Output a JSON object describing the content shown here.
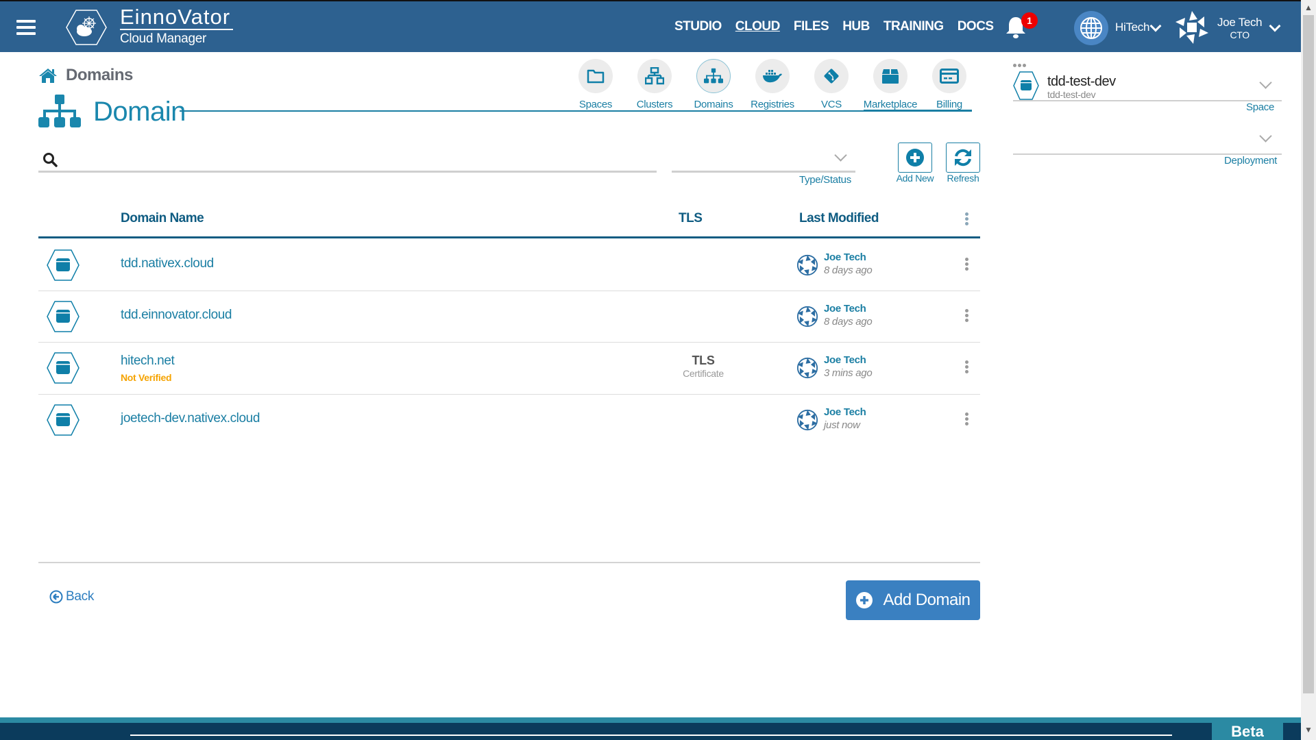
{
  "app": {
    "brand_name": "EinnoVator",
    "brand_sub": "Cloud Manager"
  },
  "topnav": [
    {
      "label": "STUDIO",
      "active": false
    },
    {
      "label": "CLOUD",
      "active": true
    },
    {
      "label": "FILES",
      "active": false
    },
    {
      "label": "HUB",
      "active": false
    },
    {
      "label": "TRAINING",
      "active": false
    },
    {
      "label": "DOCS",
      "active": false
    }
  ],
  "notifications": {
    "count": "1",
    "icon": "bell-icon"
  },
  "org": {
    "name": "HiTech",
    "icon": "globe-icon"
  },
  "user": {
    "name": "Joe Tech",
    "role": "CTO"
  },
  "breadcrumb": {
    "label": "Domains",
    "icon": "home-icon"
  },
  "page": {
    "title": "Domain",
    "icon": "sitemap-icon"
  },
  "quicknav": [
    {
      "label": "Spaces",
      "icon": "folder-icon"
    },
    {
      "label": "Clusters",
      "icon": "network-icon"
    },
    {
      "label": "Domains",
      "icon": "sitemap-icon",
      "active": true
    },
    {
      "label": "Registries",
      "icon": "docker-icon"
    },
    {
      "label": "VCS",
      "icon": "git-icon"
    },
    {
      "label": "Marketplace",
      "icon": "box-icon"
    },
    {
      "label": "Billing",
      "icon": "credit-card-icon"
    }
  ],
  "search": {
    "value": "",
    "placeholder": ""
  },
  "filter": {
    "label": "Type/Status",
    "value": ""
  },
  "toolbar": {
    "add_new": "Add New",
    "refresh": "Refresh"
  },
  "table": {
    "columns": [
      "Domain Name",
      "TLS",
      "Last Modified"
    ],
    "rows": [
      {
        "name": "tdd.nativex.cloud",
        "status": "",
        "tls": "",
        "tls_sub": "",
        "user": "Joe Tech",
        "time": "8 days ago"
      },
      {
        "name": "tdd.einnovator.cloud",
        "status": "",
        "tls": "",
        "tls_sub": "",
        "user": "Joe Tech",
        "time": "8 days ago"
      },
      {
        "name": "hitech.net",
        "status": "Not Verified",
        "tls": "TLS",
        "tls_sub": "Certificate",
        "user": "Joe Tech",
        "time": "3 mins ago"
      },
      {
        "name": "joetech-dev.nativex.cloud",
        "status": "",
        "tls": "",
        "tls_sub": "",
        "user": "Joe Tech",
        "time": "just now"
      }
    ]
  },
  "actions": {
    "back": "Back",
    "add_domain": "Add Domain"
  },
  "right_panel": {
    "space_name": "tdd-test-dev",
    "space_sub": "tdd-test-dev",
    "space_label": "Space",
    "deployment_value": "",
    "deployment_label": "Deployment"
  },
  "footer": {
    "beta": "Beta"
  },
  "colors": {
    "header": "#2d6190",
    "accent": "#1a7ea3",
    "button": "#3a80c1",
    "warning": "#f5a300",
    "footer": "#0b3b5c"
  }
}
